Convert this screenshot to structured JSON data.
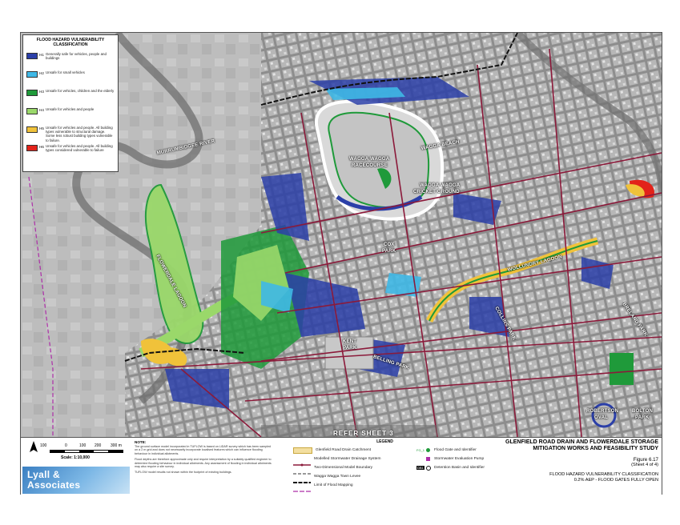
{
  "hazard_legend": {
    "title": "FLOOD HAZARD VULNERABILITY CLASSIFICATION",
    "classes": [
      {
        "code": "H1",
        "color": "#2b3fa8",
        "desc": "Generally safe for vehicles, people and buildings"
      },
      {
        "code": "H2",
        "color": "#3fb8e6",
        "desc": "Unsafe for small vehicles"
      },
      {
        "code": "H3",
        "color": "#1f9a3a",
        "desc": "Unsafe for vehicles, children and the elderly"
      },
      {
        "code": "H4",
        "color": "#9ad86a",
        "desc": "Unsafe for vehicles and people"
      },
      {
        "code": "H5",
        "color": "#f0c23a",
        "desc": "Unsafe for vehicles and people. All building types vulnerable to structural damage. Some less robust building types vulnerable to failure."
      },
      {
        "code": "H6",
        "color": "#e2231a",
        "desc": "Unsafe for vehicles and people. All building types considered vulnerable to failure"
      }
    ]
  },
  "map_labels": {
    "murrumbidgee": "MURRUMBIDGEE RIVER",
    "racecourse1": "WAGGA WAGGA",
    "racecourse2": "RACECOURSE",
    "cricket1": "WAGGA WAGGA",
    "cricket2": "CRICKET GROUND",
    "wagga_beach": "WAGGA BEACH",
    "flowerdale": "FLOWERDALE LAGOON",
    "wollundry": "WOLLUNDRY LAGOON",
    "cox_park1": "COX",
    "cox_park2": "PARK",
    "kent_park1": "KENT",
    "kent_park2": "PARK",
    "bellinger": "BELLING PARK",
    "collins": "COLLINS PARK",
    "breland": "BRELAND PARK",
    "robertson1": "ROBERTSON",
    "robertson2": "OVAL",
    "bolton1": "BOLTON",
    "bolton2": "PARK"
  },
  "refer_sheet": "REFER SHEET 3",
  "scale": {
    "north": "N",
    "ticks": [
      "100",
      "0",
      "100",
      "200",
      "300 m"
    ],
    "text": "Scale: 1:10,000"
  },
  "logo": {
    "line1": "Lyall &",
    "line2": "Associates"
  },
  "note": {
    "title": "NOTE:",
    "paragraphs": [
      "The ground surface model incorporated in TUFLOW is based on LiDAR survey which has been sampled on a 2 m grid and does not necessarily incorporate localised features which can influence flooding behaviour in individual allotments.",
      "Flood depths are therefore approximate only and require interpretation by a suitably qualified engineer to determine flooding behaviour in individual allotments. Any assessment of flooding in individual allotments may also require a site survey.",
      "TUFLOW model results not shown within the footprint of existing buildings."
    ]
  },
  "legend": {
    "title": "LEGEND",
    "items": [
      {
        "label": "Glenfield Road Drain Catchment"
      },
      {
        "label": "Modelled Stormwater Drainage System"
      },
      {
        "label": "Two-Dimensional Model Boundary"
      },
      {
        "label": "Wagga Wagga Town Levee"
      },
      {
        "label": "Limit of Flood Mapping"
      },
      {
        "label": "Flood Gate and Identifier",
        "code": "FG_1"
      },
      {
        "label": "Stormwater Evaluation Pump"
      },
      {
        "label": "Detention Basin and Identifier",
        "code": "DB1"
      }
    ]
  },
  "title_block": {
    "line1": "GLENFIELD ROAD DRAIN AND FLOWERDALE STORAGE",
    "line2": "MITIGATION WORKS AND FEASIBILITY STUDY",
    "figure": "Figure 6.17",
    "sheet": "(Sheet 4 of 4)",
    "sub1": "FLOOD HAZARD VULNERABILITY CLASSIFICATION",
    "sub2": "0.2% AEP - FLOOD GATES FULLY OPEN"
  }
}
